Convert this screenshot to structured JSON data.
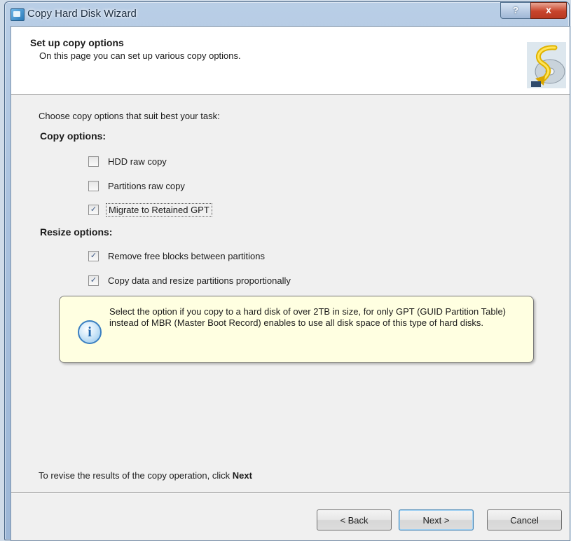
{
  "window": {
    "title": "Copy Hard Disk Wizard",
    "help_label": "?",
    "close_label": "x"
  },
  "header": {
    "title": "Set up copy options",
    "subtitle": "On this page you can set up various copy options."
  },
  "content": {
    "intro": "Choose copy options that suit best your task:",
    "copy_options_heading": "Copy options:",
    "copy_options": [
      {
        "label": "HDD raw copy",
        "checked": false
      },
      {
        "label": "Partitions raw copy",
        "checked": false
      },
      {
        "label": "Migrate to Retained GPT",
        "checked": true
      }
    ],
    "resize_options_heading": "Resize options:",
    "resize_options": [
      {
        "label": "Remove free blocks between partitions",
        "checked": true
      },
      {
        "label": "Copy data and resize partitions proportionally",
        "checked": true
      }
    ],
    "info_text": "Select the option if you copy to a hard disk of over 2TB in size, for only GPT (GUID Partition Table) instead of MBR (Master Boot Record) enables to use all disk space of this type of hard disks.",
    "footer_text": "To revise the results of the copy operation, click",
    "footer_bold": "Next"
  },
  "buttons": {
    "back": "< Back",
    "next": "Next >",
    "cancel": "Cancel"
  },
  "colors": {
    "info_background": "#ffffe1",
    "info_icon": "#3a7fc1",
    "checkmark": "#3d5a86"
  }
}
